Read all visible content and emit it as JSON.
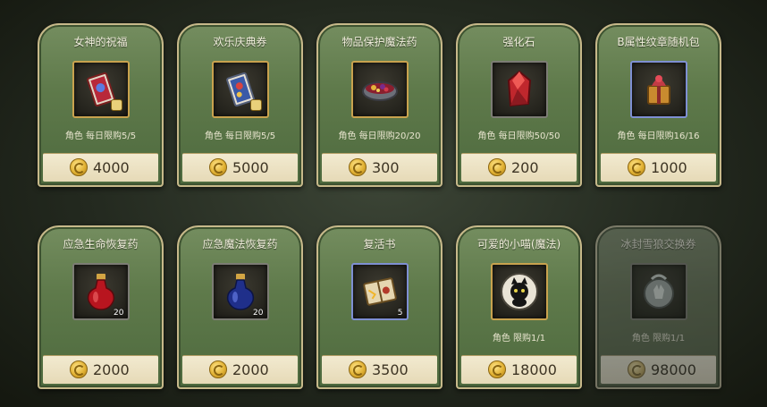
{
  "currency_icon": "gold-coin-icon",
  "items": [
    {
      "name": "女神的祝福",
      "limit": "角色 每日限购5/5",
      "price": "4000",
      "icon": "blessing-card-icon",
      "frame": "gold",
      "qty": "",
      "disabled": false
    },
    {
      "name": "欢乐庆典券",
      "limit": "角色 每日限购5/5",
      "price": "5000",
      "icon": "celebration-ticket-icon",
      "frame": "gold",
      "qty": "",
      "disabled": false
    },
    {
      "name": "物品保护魔法药",
      "limit": "角色 每日限购20/20",
      "price": "300",
      "icon": "protection-potion-bowl-icon",
      "frame": "gold",
      "qty": "",
      "disabled": false
    },
    {
      "name": "强化石",
      "limit": "角色 每日限购50/50",
      "price": "200",
      "icon": "red-crystal-icon",
      "frame": "gray",
      "qty": "",
      "disabled": false
    },
    {
      "name": "B属性纹章随机包",
      "limit": "角色 每日限购16/16",
      "price": "1000",
      "icon": "emblem-pack-icon",
      "frame": "blue",
      "qty": "",
      "disabled": false
    },
    {
      "name": "应急生命恢复药",
      "limit": "",
      "price": "2000",
      "icon": "red-potion-icon",
      "frame": "gray",
      "qty": "20",
      "disabled": false
    },
    {
      "name": "应急魔法恢复药",
      "limit": "",
      "price": "2000",
      "icon": "blue-potion-icon",
      "frame": "gray",
      "qty": "20",
      "disabled": false
    },
    {
      "name": "复活书",
      "limit": "",
      "price": "3500",
      "icon": "revival-book-icon",
      "frame": "blue",
      "qty": "5",
      "disabled": false
    },
    {
      "name": "可爱的小喵(魔法)",
      "limit": "角色 限购1/1",
      "price": "18000",
      "icon": "black-cat-pet-icon",
      "frame": "gold",
      "qty": "",
      "disabled": false
    },
    {
      "name": "冰封雪狼交换券",
      "limit": "角色 限购1/1",
      "price": "98000",
      "icon": "snow-wolf-ticket-icon",
      "frame": "gray",
      "qty": "",
      "disabled": true
    }
  ]
}
